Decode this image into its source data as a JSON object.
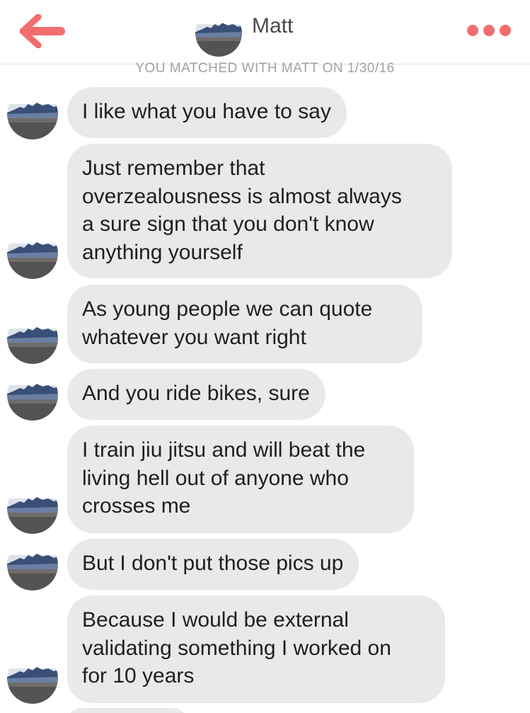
{
  "header": {
    "contact_name": "Matt",
    "back_icon": "back-arrow-icon",
    "more_icon": "more-dots-icon",
    "accent_color": "#f26d6d"
  },
  "match_info": {
    "text": "YOU MATCHED WITH MATT ON 1/30/16"
  },
  "messages": [
    {
      "text": "I like what you have to say"
    },
    {
      "text": "Just remember that\noverzealousness is almost always\na sure sign that you don't know\nanything yourself"
    },
    {
      "text": "As young people we can quote\nwhatever you want right"
    },
    {
      "text": "And you ride bikes, sure"
    },
    {
      "text": "I train jiu jitsu and will beat the\nliving hell out of anyone who\ncrosses me"
    },
    {
      "text": "But I don't put those pics up"
    },
    {
      "text": "Because I would be external\nvalidating something I worked on\nfor 10 years"
    }
  ],
  "colors": {
    "bubble": "#e9e9e9",
    "message_text": "#1f1f1f",
    "match_text": "#a2a2a2"
  }
}
